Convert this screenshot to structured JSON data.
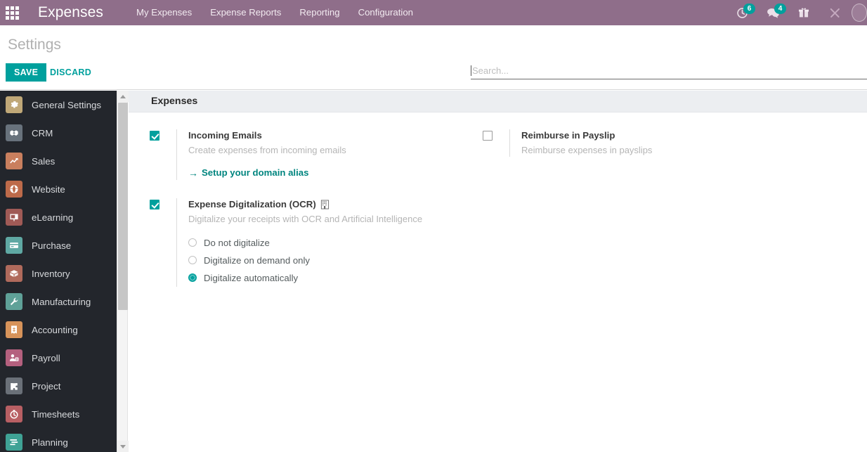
{
  "navbar": {
    "apps_icon": "apps-grid-icon",
    "brand": "Expenses",
    "menu": [
      {
        "label": "My Expenses"
      },
      {
        "label": "Expense Reports"
      },
      {
        "label": "Reporting"
      },
      {
        "label": "Configuration"
      }
    ],
    "systray": [
      {
        "icon": "activity-clock-icon",
        "badge": "6"
      },
      {
        "icon": "messaging-chat-icon",
        "badge": "4"
      },
      {
        "icon": "gift-icon",
        "badge": ""
      },
      {
        "icon": "tools-wrench-icon",
        "badge": ""
      }
    ],
    "avatar": "user-avatar"
  },
  "control_panel": {
    "title": "Settings",
    "save_label": "SAVE",
    "discard_label": "DISCARD"
  },
  "search": {
    "value": "",
    "placeholder": "Search..."
  },
  "sidebar": {
    "items": [
      {
        "label": "General Settings",
        "icon": "gear-icon",
        "color": "#c0a878"
      },
      {
        "label": "CRM",
        "icon": "handshake-icon",
        "color": "#68727c"
      },
      {
        "label": "Sales",
        "icon": "chart-line-icon",
        "color": "#c97f5e"
      },
      {
        "label": "Website",
        "icon": "globe-icon",
        "color": "#bd6a4a"
      },
      {
        "label": "eLearning",
        "icon": "presentation-icon",
        "color": "#a05a56"
      },
      {
        "label": "Purchase",
        "icon": "credit-card-icon",
        "color": "#5fa8a3"
      },
      {
        "label": "Inventory",
        "icon": "package-icon",
        "color": "#b06a5c"
      },
      {
        "label": "Manufacturing",
        "icon": "wrench-icon",
        "color": "#5fa198"
      },
      {
        "label": "Accounting",
        "icon": "invoice-icon",
        "color": "#d7935a"
      },
      {
        "label": "Payroll",
        "icon": "user-payroll-icon",
        "color": "#b4607e"
      },
      {
        "label": "Project",
        "icon": "puzzle-icon",
        "color": "#6a7078"
      },
      {
        "label": "Timesheets",
        "icon": "stopwatch-icon",
        "color": "#b85f63"
      },
      {
        "label": "Planning",
        "icon": "planning-bars-icon",
        "color": "#3fa295"
      }
    ]
  },
  "main": {
    "section_title": "Expenses",
    "left_settings": [
      {
        "name": "incoming-emails",
        "checked": true,
        "label": "Incoming Emails",
        "description": "Create expenses from incoming emails",
        "link": "Setup your domain alias",
        "link_arrow": "→"
      },
      {
        "name": "expense-digitalization",
        "checked": true,
        "label": "Expense Digitalization (OCR)",
        "enterprise_icon": "building-enterprise-icon",
        "description": "Digitalize your receipts with OCR and Artificial Intelligence",
        "radios": [
          {
            "label": "Do not digitalize",
            "selected": false
          },
          {
            "label": "Digitalize on demand only",
            "selected": false
          },
          {
            "label": "Digitalize automatically",
            "selected": true
          }
        ]
      }
    ],
    "right_settings": [
      {
        "name": "reimburse-in-payslip",
        "checked": false,
        "label": "Reimburse in Payslip",
        "description": "Reimburse expenses in payslips"
      }
    ]
  },
  "colors": {
    "navbar": "#8f6e8a",
    "accent": "#00a09d",
    "sidebar": "#23262c",
    "section_band": "#eceef1"
  }
}
